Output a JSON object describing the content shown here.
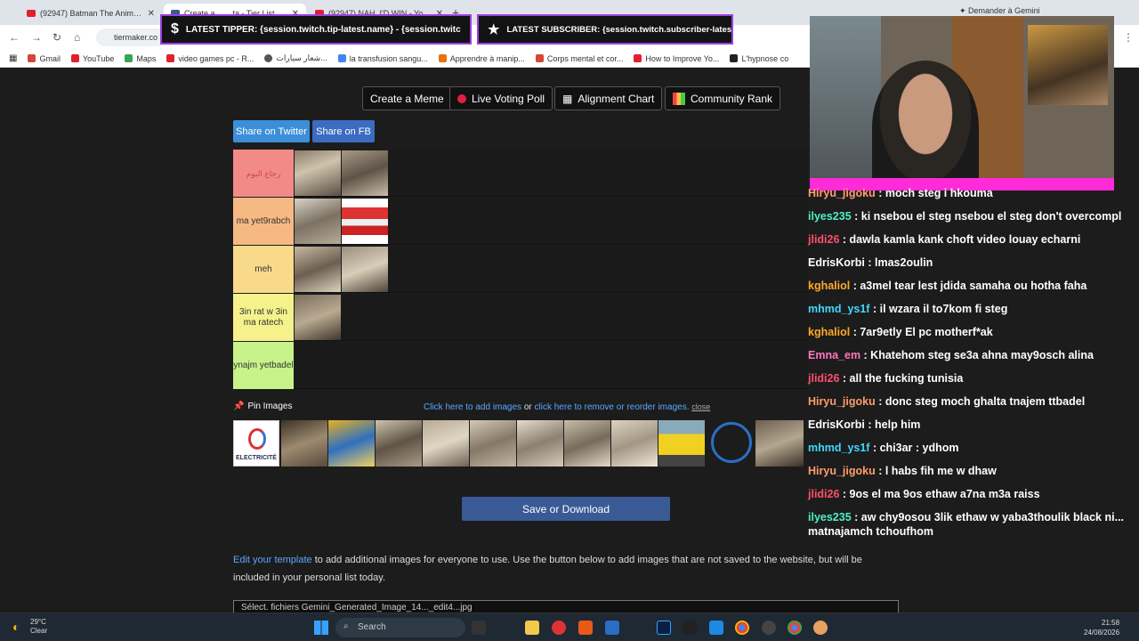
{
  "browser": {
    "tabs": [
      {
        "label": "(92947) Batman The Animated"
      },
      {
        "label": "Create a ... ...ta - Tier List - TierMaker"
      },
      {
        "label": "(92947) NAH, I'D WIN - Yo"
      }
    ],
    "gemini_label": "Demander à Gemini",
    "url": "tiermaker.co",
    "bookmarks": [
      "Gmail",
      "YouTube",
      "Maps",
      "video games pc - R...",
      "شعار سيارات...",
      "la transfusion sangu...",
      "Apprendre à manip...",
      "Corps mental et cor...",
      "How to Improve Yo...",
      "L'hypnose co"
    ]
  },
  "overlay": {
    "tipper": "LATEST TIPPER: {session.twitch.tip-latest.name} - {session.twitch.tip-latest.amount}",
    "subscriber": "LATEST SUBSCRIBER: {session.twitch.subscriber-latest.name}"
  },
  "toolbar": {
    "meme": "Create a Meme",
    "poll": "Live Voting Poll",
    "alignment": "Alignment Chart",
    "rank": "Community Rank"
  },
  "share": {
    "twitter": "Share on Twitter",
    "fb": "Share on FB"
  },
  "tiers": [
    {
      "label": "رجاع اليوم",
      "color": "#f28b87",
      "count": 2
    },
    {
      "label": "ma yet9rabch",
      "color": "#f6b984",
      "count": 2
    },
    {
      "label": "meh",
      "color": "#f9d98a",
      "count": 2
    },
    {
      "label": "3in rat w 3in ma ratech",
      "color": "#f5f28c",
      "count": 1
    },
    {
      "label": "ynajm yetbadel",
      "color": "#c7f38a",
      "count": 0
    }
  ],
  "pin": {
    "label": "Pin Images",
    "add_link": "Click here to add images",
    "or": " or ",
    "remove_link": "click here to remove or reorder images.",
    "close": "close"
  },
  "save_label": "Save or Download",
  "edit": {
    "link": "Edit your template",
    "text": " to add additional images for everyone to use. Use the button below to add images that are not saved to the website, but will be included in your personal list today."
  },
  "file_input": "Sélect. fichiers   Gemini_Generated_Image_14..._edit4...jpg",
  "chat": [
    {
      "user": "Hiryu_jigoku",
      "color": "#ff9c6b",
      "text": " : moch steg i hkouma"
    },
    {
      "user": "ilyes235",
      "color": "#4ef0c4",
      "text": " : ki nsebou el steg nsebou el steg don't overcompl"
    },
    {
      "user": "jlidi26",
      "color": "#ff4f6e",
      "text": " : dawla kamla kank choft video louay echarni"
    },
    {
      "user": "EdrisKorbi",
      "color": "#ffffff",
      "text": " : lmas2oulin"
    },
    {
      "user": "kghaliol",
      "color": "#ffa928",
      "text": " : a3mel tear lest jdida samaha ou hotha faha"
    },
    {
      "user": "mhmd_ys1f",
      "color": "#3fd8ff",
      "text": " : il wzara il to7kom fi steg"
    },
    {
      "user": "kghaliol",
      "color": "#ffa928",
      "text": " : 7ar9etly El pc motherf*ak"
    },
    {
      "user": "Emna_em",
      "color": "#ff74c0",
      "text": " : Khatehom steg se3a ahna may9osch alina"
    },
    {
      "user": "jlidi26",
      "color": "#ff4f6e",
      "text": " : all the fucking tunisia"
    },
    {
      "user": "Hiryu_jigoku",
      "color": "#ff9c6b",
      "text": " : donc steg moch ghalta tnajem ttbadel"
    },
    {
      "user": "EdrisKorbi",
      "color": "#ffffff",
      "text": " : help him"
    },
    {
      "user": "mhmd_ys1f",
      "color": "#3fd8ff",
      "text": " : chi3ar : ydhom"
    },
    {
      "user": "Hiryu_jigoku",
      "color": "#ff9c6b",
      "text": " : l habs fih me w dhaw"
    },
    {
      "user": "jlidi26",
      "color": "#ff4f6e",
      "text": " : 9os el ma 9os ethaw a7na m3a raiss"
    },
    {
      "user": "ilyes235",
      "color": "#4ef0c4",
      "text": " : aw chy9osou 3lik ethaw w yaba3thoulik black ni..."
    },
    {
      "user": "",
      "color": "#ffffff",
      "text": "matnajamch tchoufhom"
    }
  ],
  "taskbar": {
    "weather_temp": "29°C",
    "weather_desc": "Clear",
    "search": "Search",
    "time": "21:58",
    "date": "24/08/2026"
  }
}
